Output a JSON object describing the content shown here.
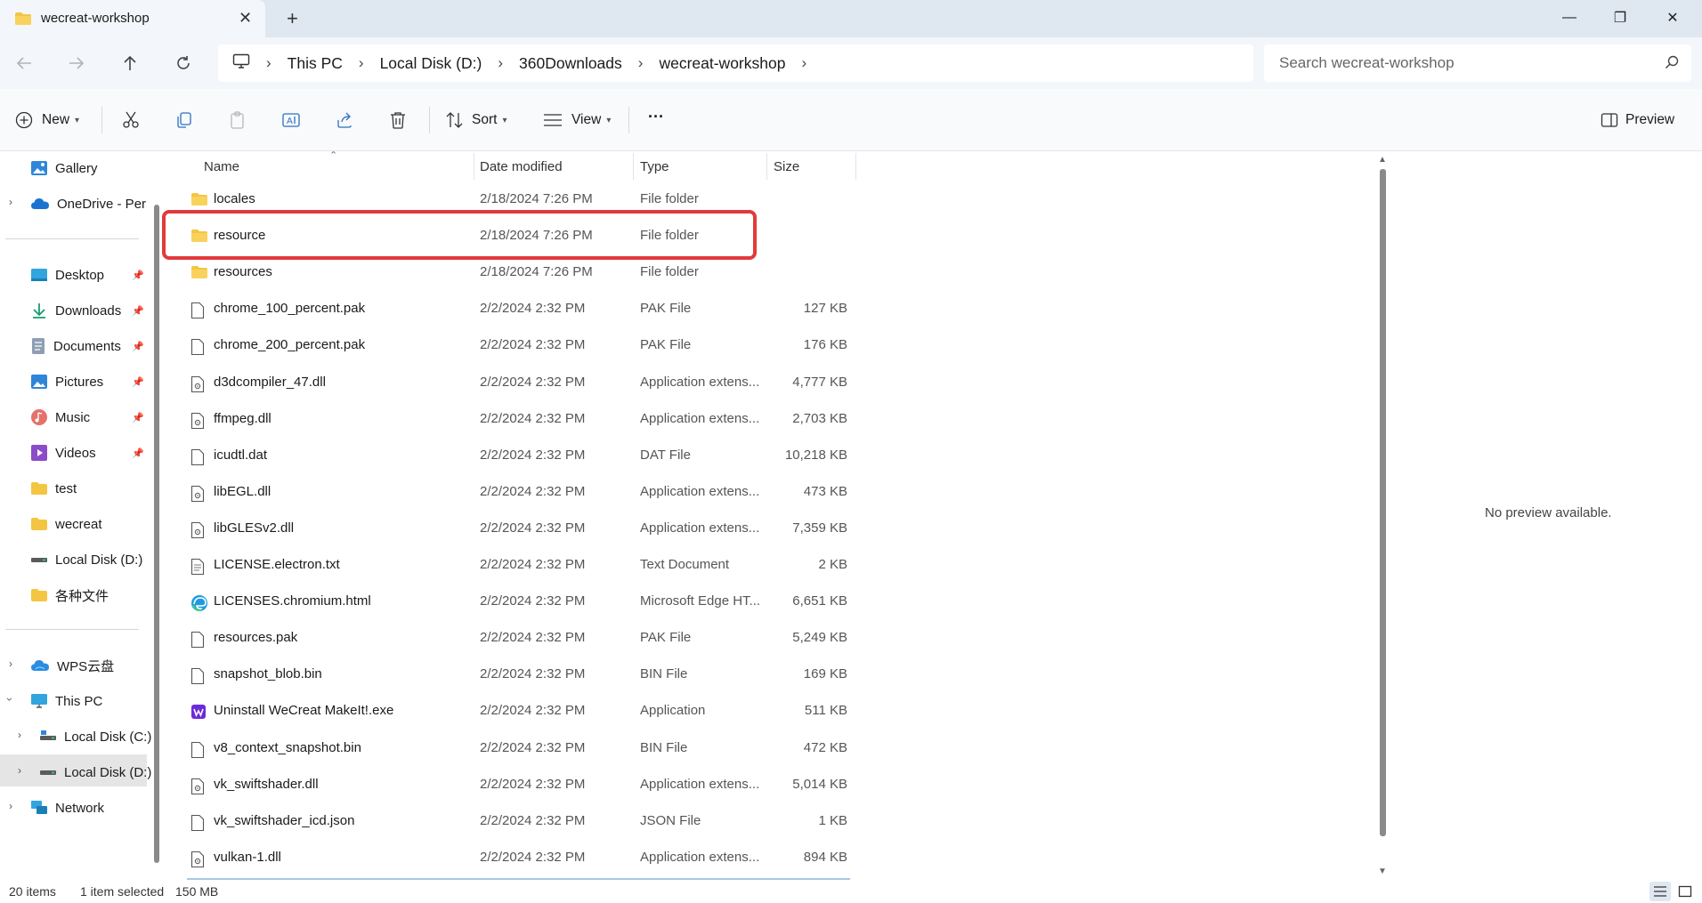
{
  "window": {
    "tab_title": "wecreat-workshop",
    "close_tab": "✕",
    "new_tab": "+",
    "minimize": "—",
    "restore": "❐",
    "close": "✕"
  },
  "address": {
    "breadcrumbs": [
      "This PC",
      "Local Disk (D:)",
      "360Downloads",
      "wecreat-workshop"
    ],
    "separator": "›",
    "search_placeholder": "Search wecreat-workshop"
  },
  "toolbar": {
    "new_label": "New",
    "sort_label": "Sort",
    "view_label": "View",
    "more_label": "···",
    "preview_label": "Preview"
  },
  "sidebar": {
    "items": [
      {
        "label": "Gallery",
        "icon": "gallery-icon"
      },
      {
        "label": "OneDrive - Perso",
        "icon": "cloud-icon"
      },
      {
        "label": "Desktop",
        "icon": "desktop-icon"
      },
      {
        "label": "Downloads",
        "icon": "download-icon"
      },
      {
        "label": "Documents",
        "icon": "documents-icon"
      },
      {
        "label": "Pictures",
        "icon": "pictures-icon"
      },
      {
        "label": "Music",
        "icon": "music-icon"
      },
      {
        "label": "Videos",
        "icon": "videos-icon"
      },
      {
        "label": "test",
        "icon": "folder-icon"
      },
      {
        "label": "wecreat",
        "icon": "folder-icon"
      },
      {
        "label": "Local Disk (D:)",
        "icon": "drive-icon"
      },
      {
        "label": "各种文件",
        "icon": "folder-icon"
      },
      {
        "label": "WPS云盘",
        "icon": "cloud-icon"
      },
      {
        "label": "This PC",
        "icon": "computer-icon"
      },
      {
        "label": "Local Disk (C:)",
        "icon": "drive-icon"
      },
      {
        "label": "Local Disk (D:)",
        "icon": "drive-icon"
      },
      {
        "label": "Network",
        "icon": "network-icon"
      }
    ],
    "pin": "📌"
  },
  "columns": {
    "name": "Name",
    "date": "Date modified",
    "type": "Type",
    "size": "Size"
  },
  "files": [
    {
      "name": "locales",
      "date": "2/18/2024 7:26 PM",
      "type": "File folder",
      "size": "",
      "icon": "folder"
    },
    {
      "name": "resource",
      "date": "2/18/2024 7:26 PM",
      "type": "File folder",
      "size": "",
      "icon": "folder"
    },
    {
      "name": "resources",
      "date": "2/18/2024 7:26 PM",
      "type": "File folder",
      "size": "",
      "icon": "folder"
    },
    {
      "name": "chrome_100_percent.pak",
      "date": "2/2/2024 2:32 PM",
      "type": "PAK File",
      "size": "127 KB",
      "icon": "file"
    },
    {
      "name": "chrome_200_percent.pak",
      "date": "2/2/2024 2:32 PM",
      "type": "PAK File",
      "size": "176 KB",
      "icon": "file"
    },
    {
      "name": "d3dcompiler_47.dll",
      "date": "2/2/2024 2:32 PM",
      "type": "Application extens...",
      "size": "4,777 KB",
      "icon": "dll"
    },
    {
      "name": "ffmpeg.dll",
      "date": "2/2/2024 2:32 PM",
      "type": "Application extens...",
      "size": "2,703 KB",
      "icon": "dll"
    },
    {
      "name": "icudtl.dat",
      "date": "2/2/2024 2:32 PM",
      "type": "DAT File",
      "size": "10,218 KB",
      "icon": "file"
    },
    {
      "name": "libEGL.dll",
      "date": "2/2/2024 2:32 PM",
      "type": "Application extens...",
      "size": "473 KB",
      "icon": "dll"
    },
    {
      "name": "libGLESv2.dll",
      "date": "2/2/2024 2:32 PM",
      "type": "Application extens...",
      "size": "7,359 KB",
      "icon": "dll"
    },
    {
      "name": "LICENSE.electron.txt",
      "date": "2/2/2024 2:32 PM",
      "type": "Text Document",
      "size": "2 KB",
      "icon": "text"
    },
    {
      "name": "LICENSES.chromium.html",
      "date": "2/2/2024 2:32 PM",
      "type": "Microsoft Edge HT...",
      "size": "6,651 KB",
      "icon": "edge"
    },
    {
      "name": "resources.pak",
      "date": "2/2/2024 2:32 PM",
      "type": "PAK File",
      "size": "5,249 KB",
      "icon": "file"
    },
    {
      "name": "snapshot_blob.bin",
      "date": "2/2/2024 2:32 PM",
      "type": "BIN File",
      "size": "169 KB",
      "icon": "file"
    },
    {
      "name": "Uninstall WeCreat MakeIt!.exe",
      "date": "2/2/2024 2:32 PM",
      "type": "Application",
      "size": "511 KB",
      "icon": "app"
    },
    {
      "name": "v8_context_snapshot.bin",
      "date": "2/2/2024 2:32 PM",
      "type": "BIN File",
      "size": "472 KB",
      "icon": "file"
    },
    {
      "name": "vk_swiftshader.dll",
      "date": "2/2/2024 2:32 PM",
      "type": "Application extens...",
      "size": "5,014 KB",
      "icon": "dll"
    },
    {
      "name": "vk_swiftshader_icd.json",
      "date": "2/2/2024 2:32 PM",
      "type": "JSON File",
      "size": "1 KB",
      "icon": "file"
    },
    {
      "name": "vulkan-1.dll",
      "date": "2/2/2024 2:32 PM",
      "type": "Application extens...",
      "size": "894 KB",
      "icon": "dll"
    }
  ],
  "preview": {
    "message": "No preview available."
  },
  "status": {
    "item_count": "20 items",
    "selection": "1 item selected",
    "selection_size": "150 MB"
  },
  "colors": {
    "folder": "#f4c542",
    "accent": "#0067c0",
    "highlight": "#e23a3a"
  }
}
